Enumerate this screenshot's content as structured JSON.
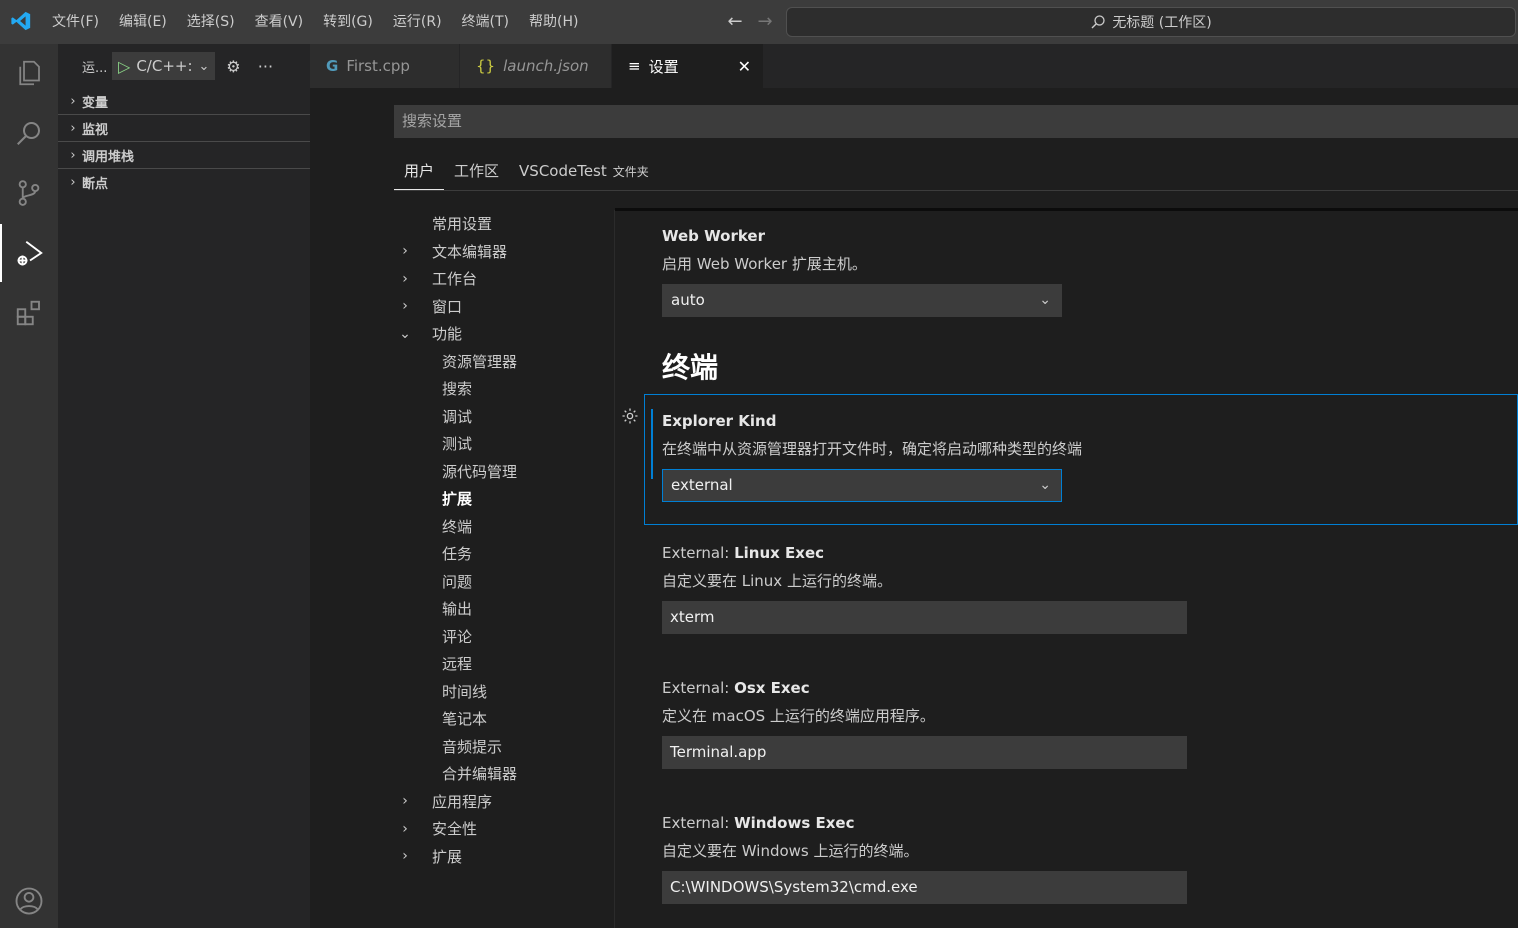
{
  "titlebar": {
    "menu": [
      "文件(F)",
      "编辑(E)",
      "选择(S)",
      "查看(V)",
      "转到(G)",
      "运行(R)",
      "终端(T)",
      "帮助(H)"
    ],
    "back_icon": "←",
    "forward_icon": "→",
    "command_center": "无标题 (工作区)"
  },
  "activitybar": {
    "icons": [
      "explorer-icon",
      "search-icon",
      "source-control-icon",
      "run-debug-icon",
      "extensions-icon",
      "account-icon"
    ],
    "active": "run-debug-icon"
  },
  "sidebar": {
    "title": "运...",
    "run_config": "C/C++:",
    "sections": [
      "变量",
      "监视",
      "调用堆栈",
      "断点"
    ]
  },
  "tabs": [
    {
      "label": "First.cpp",
      "icon": "C"
    },
    {
      "label": "launch.json",
      "icon": "{}"
    },
    {
      "label": "设置",
      "icon": "≡",
      "active": true
    }
  ],
  "settings": {
    "search_placeholder": "搜索设置",
    "scopes": [
      "用户",
      "工作区",
      "VSCodeTest",
      "文件夹"
    ],
    "toc": [
      {
        "label": "常用设置",
        "level": 1,
        "chevron": "none"
      },
      {
        "label": "文本编辑器",
        "level": 1,
        "chevron": "right"
      },
      {
        "label": "工作台",
        "level": 1,
        "chevron": "right"
      },
      {
        "label": "窗口",
        "level": 1,
        "chevron": "right"
      },
      {
        "label": "功能",
        "level": 1,
        "chevron": "down"
      },
      {
        "label": "资源管理器",
        "level": 2
      },
      {
        "label": "搜索",
        "level": 2
      },
      {
        "label": "调试",
        "level": 2
      },
      {
        "label": "测试",
        "level": 2
      },
      {
        "label": "源代码管理",
        "level": 2
      },
      {
        "label": "扩展",
        "level": 2,
        "bold": true
      },
      {
        "label": "终端",
        "level": 2
      },
      {
        "label": "任务",
        "level": 2
      },
      {
        "label": "问题",
        "level": 2
      },
      {
        "label": "输出",
        "level": 2
      },
      {
        "label": "评论",
        "level": 2
      },
      {
        "label": "远程",
        "level": 2
      },
      {
        "label": "时间线",
        "level": 2
      },
      {
        "label": "笔记本",
        "level": 2
      },
      {
        "label": "音频提示",
        "level": 2
      },
      {
        "label": "合并编辑器",
        "level": 2
      },
      {
        "label": "应用程序",
        "level": 1,
        "chevron": "right"
      },
      {
        "label": "安全性",
        "level": 1,
        "chevron": "right"
      },
      {
        "label": "扩展",
        "level": 1,
        "chevron": "right"
      }
    ],
    "web_worker": {
      "title": "Web Worker",
      "desc": "启用 Web Worker 扩展主机。",
      "value": "auto"
    },
    "section_heading": "终端",
    "explorer_kind": {
      "title": "Explorer Kind",
      "desc": "在终端中从资源管理器打开文件时，确定将启动哪种类型的终端",
      "value": "external"
    },
    "linux_exec": {
      "category": "External: ",
      "title": "Linux Exec",
      "desc": "自定义要在 Linux 上运行的终端。",
      "value": "xterm"
    },
    "osx_exec": {
      "category": "External: ",
      "title": "Osx Exec",
      "desc": "定义在 macOS 上运行的终端应用程序。",
      "value": "Terminal.app"
    },
    "windows_exec": {
      "category": "External: ",
      "title": "Windows Exec",
      "desc": "自定义要在 Windows 上运行的终端。",
      "value": "C:\\WINDOWS\\System32\\cmd.exe"
    }
  },
  "colors": {
    "accent": "#007fd4",
    "logo": "#23a9f2",
    "run": "#89d185"
  }
}
